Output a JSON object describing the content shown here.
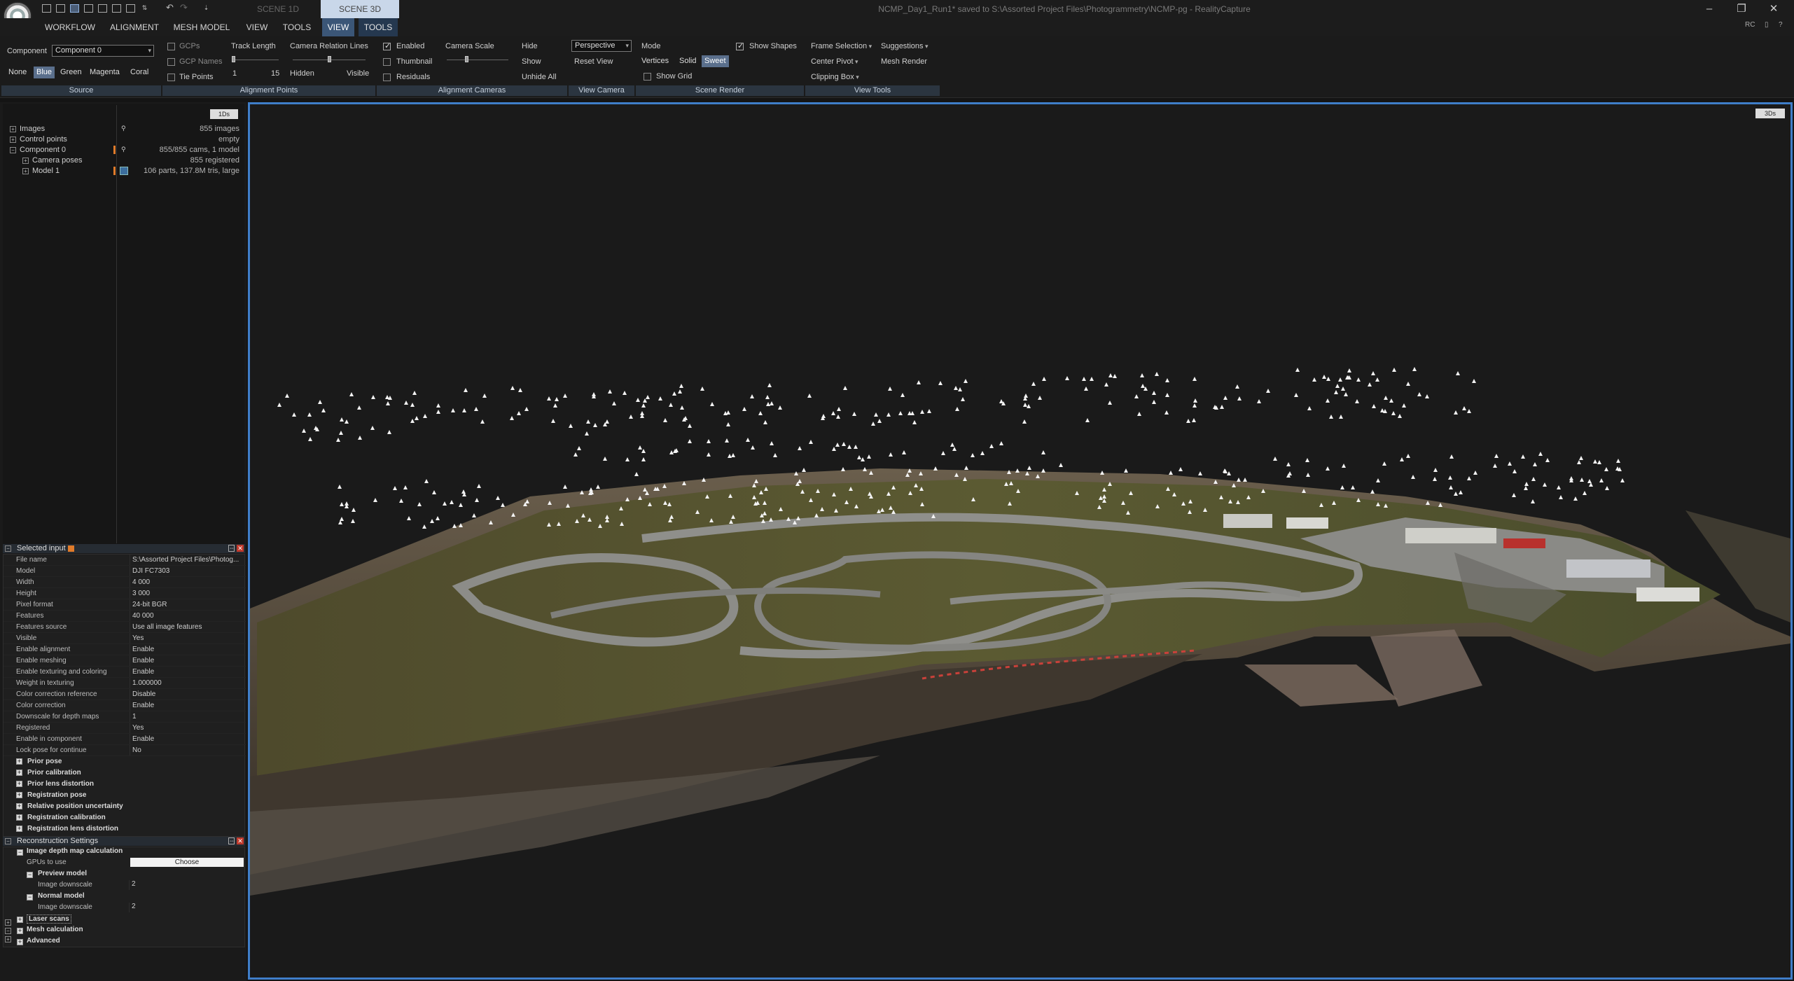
{
  "app": {
    "window_title": "NCMP_Day1_Run1* saved to S:\\Assorted Project Files\\Photogrammetry\\NCMP-pg - RealityCapture",
    "scene_tabs": [
      "SCENE 1D",
      "SCENE 3D"
    ],
    "window_controls": {
      "minimize": "–",
      "maximize": "❐",
      "close": "✕"
    }
  },
  "menu": {
    "items": [
      "WORKFLOW",
      "ALIGNMENT",
      "MESH MODEL",
      "VIEW",
      "TOOLS"
    ],
    "active_items": [
      "VIEW",
      "TOOLS"
    ],
    "right": [
      "RC"
    ]
  },
  "ribbon": {
    "source": {
      "component_label": "Component",
      "component_value": "Component 0",
      "colors": [
        "None",
        "Blue",
        "Green",
        "Magenta",
        "Coral"
      ],
      "selected_color": "Blue",
      "group_label": "Source"
    },
    "alignment_points": {
      "gcps": "GCPs",
      "gcp_names": "GCP Names",
      "tie_points": "Tie Points",
      "track_length": "Track Length",
      "track_min": "1",
      "track_max": "15",
      "camera_relation_lines": "Camera Relation Lines",
      "hidden": "Hidden",
      "visible": "Visible",
      "group_label": "Alignment Points"
    },
    "alignment_cameras": {
      "enabled": "Enabled",
      "thumbnail": "Thumbnail",
      "residuals": "Residuals",
      "camera_scale": "Camera Scale",
      "hide": "Hide",
      "show": "Show",
      "unhide_all": "Unhide All",
      "group_label": "Alignment Cameras"
    },
    "view_camera": {
      "projection": "Perspective",
      "reset_view": "Reset View",
      "group_label": "View Camera"
    },
    "scene_render": {
      "mode": "Mode",
      "modes": [
        "Vertices",
        "Solid",
        "Sweet"
      ],
      "selected_mode": "Sweet",
      "show_shapes": "Show Shapes",
      "show_grid": "Show Grid",
      "group_label": "Scene Render"
    },
    "view_tools": {
      "frame_selection": "Frame Selection",
      "suggestions": "Suggestions",
      "center_pivot": "Center Pivot",
      "mesh_render": "Mesh Render",
      "clipping_box": "Clipping Box",
      "group_label": "View Tools"
    }
  },
  "tree": {
    "badge": "1Ds",
    "rows": [
      {
        "label": "Images",
        "value": "855 images"
      },
      {
        "label": "Control points",
        "value": "empty"
      },
      {
        "label": "Component 0",
        "value": "855/855 cams, 1 model"
      },
      {
        "label": "Camera poses",
        "value": "855 registered"
      },
      {
        "label": "Model 1",
        "value": "106 parts, 137.8M tris, large"
      }
    ]
  },
  "selected_input": {
    "title": "Selected input",
    "rows": [
      {
        "k": "File name",
        "v": "S:\\Assorted Project Files\\Photog..."
      },
      {
        "k": "Model",
        "v": "DJI FC7303"
      },
      {
        "k": "Width",
        "v": "4 000"
      },
      {
        "k": "Height",
        "v": "3 000"
      },
      {
        "k": "Pixel format",
        "v": "24-bit BGR"
      },
      {
        "k": "Features",
        "v": "40 000"
      },
      {
        "k": "Features source",
        "v": "Use all image features"
      },
      {
        "k": "Visible",
        "v": "Yes"
      },
      {
        "k": "Enable alignment",
        "v": "Enable"
      },
      {
        "k": "Enable meshing",
        "v": "Enable"
      },
      {
        "k": "Enable texturing and coloring",
        "v": "Enable"
      },
      {
        "k": "Weight in texturing",
        "v": "1.000000"
      },
      {
        "k": "Color correction reference",
        "v": "Disable"
      },
      {
        "k": "Color correction",
        "v": "Enable"
      },
      {
        "k": "Downscale for depth maps",
        "v": "1"
      },
      {
        "k": "Registered",
        "v": "Yes"
      },
      {
        "k": "Enable in component",
        "v": "Enable"
      },
      {
        "k": "Lock pose for continue",
        "v": "No"
      }
    ],
    "groups": [
      "Prior pose",
      "Prior calibration",
      "Prior lens distortion",
      "Registration pose",
      "Relative position uncertainty",
      "Registration calibration",
      "Registration lens distortion"
    ]
  },
  "reconstruction": {
    "title": "Reconstruction Settings",
    "section": "Image depth map calculation",
    "gpus_label": "GPUs to use",
    "choose_label": "Choose",
    "preview_model": "Preview model",
    "normal_model": "Normal model",
    "image_downscale_label": "Image downscale",
    "preview_downscale": "2",
    "normal_downscale": "2",
    "groups": [
      "Laser scans",
      "Mesh calculation",
      "Advanced"
    ]
  },
  "viewport": {
    "badge": "3Ds",
    "selection_color": "#3f7ec9"
  }
}
